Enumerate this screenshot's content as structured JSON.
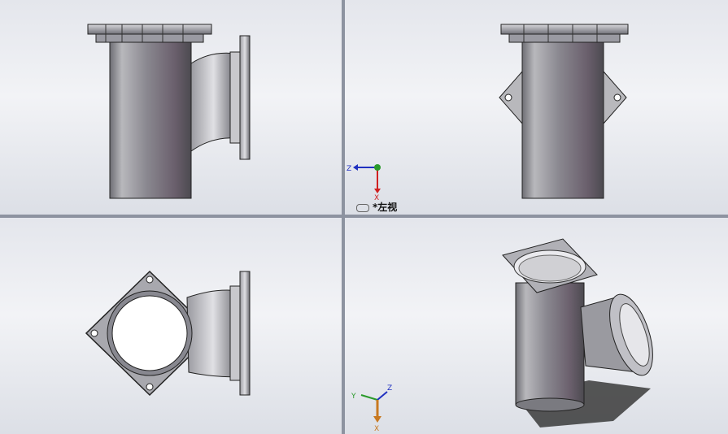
{
  "viewports": {
    "top_left": {
      "name": "front-view"
    },
    "top_right": {
      "name": "left-view",
      "label": "*左视"
    },
    "bottom_left": {
      "name": "top-view"
    },
    "bottom_right": {
      "name": "isometric-view"
    }
  },
  "triads": {
    "left_view": {
      "axis1": "Z",
      "axis2": "X"
    },
    "isometric": {
      "axis1": "Y",
      "axis2": "Z",
      "axis3": "X"
    }
  },
  "colors": {
    "background_top": "#e4e6ec",
    "background_bottom": "#dcdfe6",
    "splitter": "#8d93a0",
    "axis_x": "#d02020",
    "axis_y": "#2a9a2a",
    "axis_z": "#2030c0",
    "axis_x_iso": "#c87820"
  },
  "icons": [
    "link-icon",
    "triad-icon"
  ]
}
